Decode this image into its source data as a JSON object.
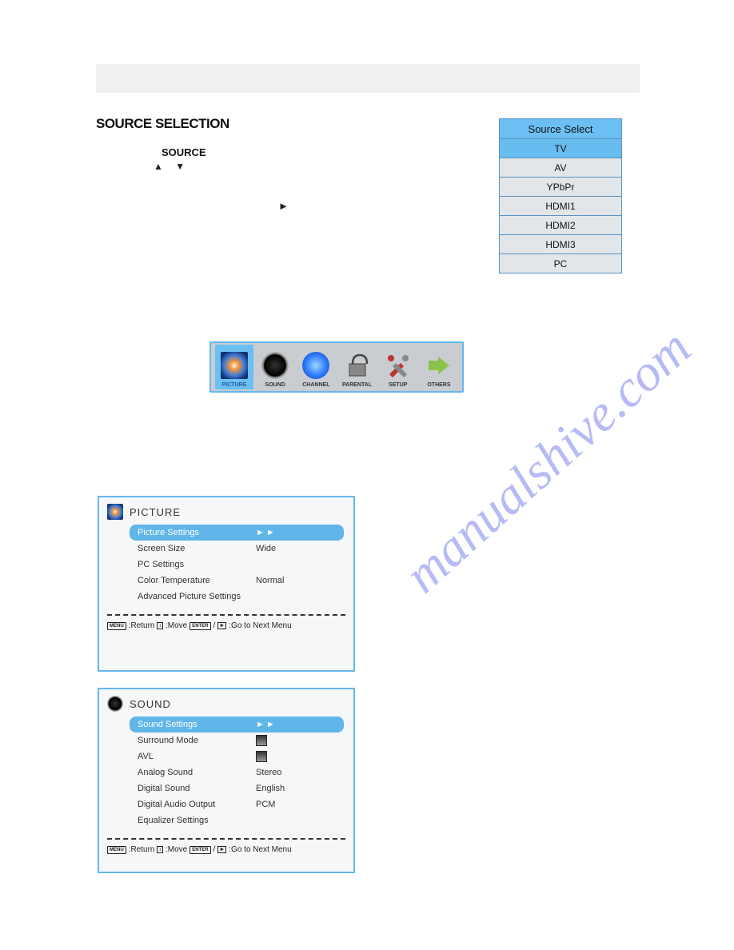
{
  "watermark": "manualshive.com",
  "sectionTitle": "SOURCE SELECTION",
  "sourceLabel": "SOURCE",
  "arrowsUpDown": "▲ ▼",
  "arrowRight": "►",
  "sourceSelect": {
    "header": "Source Select",
    "items": [
      "TV",
      "AV",
      "YPbPr",
      "HDMI1",
      "HDMI2",
      "HDMI3",
      "PC"
    ],
    "selectedIndex": 0
  },
  "toolbar": {
    "items": [
      {
        "label": "PICTURE",
        "icon": "picture-icon",
        "selected": true
      },
      {
        "label": "SOUND",
        "icon": "sound-icon"
      },
      {
        "label": "CHANNEL",
        "icon": "channel-icon"
      },
      {
        "label": "PARENTAL",
        "icon": "parental-icon"
      },
      {
        "label": "SETUP",
        "icon": "setup-icon"
      },
      {
        "label": "OTHERS",
        "icon": "others-icon"
      }
    ]
  },
  "picturePanel": {
    "title": "PICTURE",
    "rows": [
      {
        "label": "Picture Settings",
        "value": "►►",
        "selected": true,
        "arrows": true
      },
      {
        "label": "Screen Size",
        "value": "Wide"
      },
      {
        "label": "PC Settings",
        "value": ""
      },
      {
        "label": "Color Temperature",
        "value": "Normal"
      },
      {
        "label": "Advanced Picture Settings",
        "value": ""
      }
    ],
    "footer": {
      "menu": "MENU",
      "return": ":Return",
      "arrows": "↕",
      "move": ":Move",
      "enter": "ENTER",
      "slash": "/",
      "play": "►",
      "next": ":Go to Next Menu"
    }
  },
  "soundPanel": {
    "title": "SOUND",
    "rows": [
      {
        "label": "Sound Settings",
        "value": "►►",
        "selected": true,
        "arrows": true
      },
      {
        "label": "Surround Mode",
        "value": "",
        "checkbox": true
      },
      {
        "label": "AVL",
        "value": "",
        "checkbox": true
      },
      {
        "label": "Analog Sound",
        "value": "Stereo"
      },
      {
        "label": "Digital Sound",
        "value": "English"
      },
      {
        "label": "Digital Audio Output",
        "value": "PCM"
      },
      {
        "label": "Equalizer Settings",
        "value": ""
      }
    ],
    "footer": {
      "menu": "MENU",
      "return": ":Return",
      "arrows": "↕",
      "move": ":Move",
      "enter": "ENTER",
      "slash": "/",
      "play": "►",
      "next": ":Go to Next Menu"
    }
  }
}
